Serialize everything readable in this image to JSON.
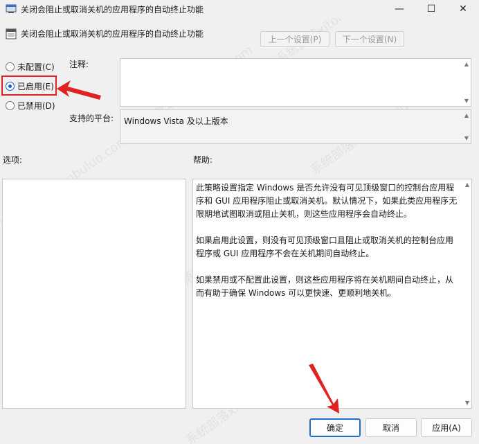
{
  "window": {
    "title": "关闭会阻止或取消关机的应用程序的自动终止功能",
    "minimize_icon": "—",
    "maximize_icon": "☐",
    "close_icon": "✕"
  },
  "header": {
    "title": "关闭会阻止或取消关机的应用程序的自动终止功能",
    "prev_label": "上一个设置(P)",
    "next_label": "下一个设置(N)"
  },
  "radios": {
    "not_configured": "未配置(C)",
    "enabled": "已启用(E)",
    "disabled": "已禁用(D)",
    "selected": "enabled"
  },
  "comment": {
    "label": "注释:",
    "value": ""
  },
  "platform": {
    "label": "支持的平台:",
    "value": "Windows Vista 及以上版本"
  },
  "options": {
    "label": "选项:"
  },
  "help": {
    "label": "帮助:",
    "paragraphs": [
      "此策略设置指定 Windows 是否允许没有可见顶级窗口的控制台应用程序和 GUI 应用程序阻止或取消关机。默认情况下，如果此类应用程序无限期地试图取消或阻止关机，则这些应用程序会自动终止。",
      "如果启用此设置，则没有可见顶级窗口且阻止或取消关机的控制台应用程序或 GUI 应用程序不会在关机期间自动终止。",
      "如果禁用或不配置此设置，则这些应用程序将在关机期间自动终止，从而有助于确保 Windows 可以更快速、更顺利地关机。"
    ]
  },
  "footer": {
    "ok_label": "确定",
    "cancel_label": "取消",
    "apply_label": "应用(A)"
  },
  "watermark": "系统部落xitongbuluo.com",
  "colors": {
    "accent": "#1560c8",
    "annotation_red": "#e02222"
  }
}
